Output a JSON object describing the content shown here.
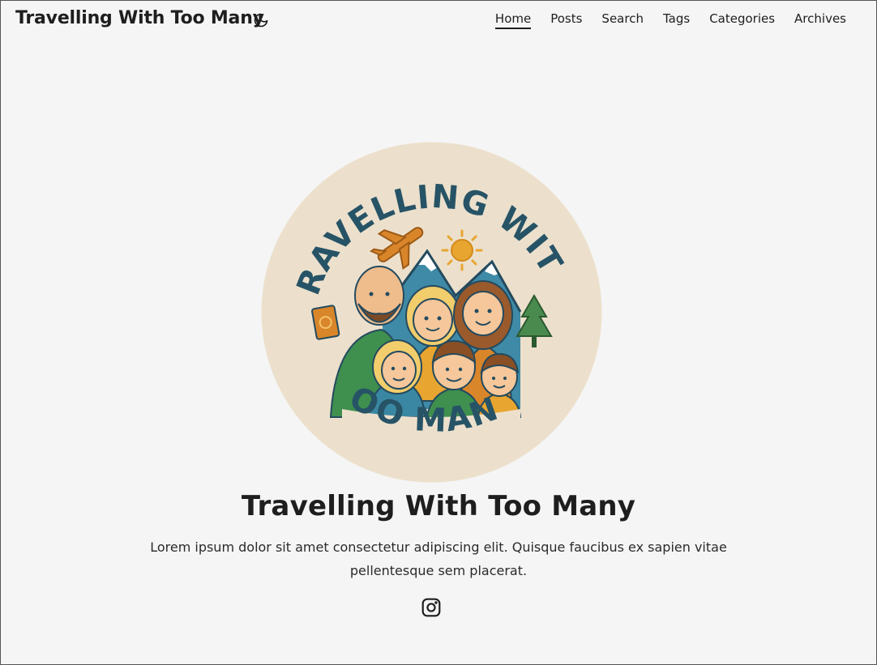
{
  "header": {
    "site_title": "Travelling With Too Many",
    "theme_toggle_icon": "moon-icon",
    "nav": [
      {
        "label": "Home",
        "active": true
      },
      {
        "label": "Posts",
        "active": false
      },
      {
        "label": "Search",
        "active": false
      },
      {
        "label": "Tags",
        "active": false
      },
      {
        "label": "Categories",
        "active": false
      },
      {
        "label": "Archives",
        "active": false
      }
    ]
  },
  "hero": {
    "logo": {
      "arc_text_top": "TRAVELLING WITH",
      "arc_text_bottom": "TOO MANY",
      "background_color": "#ece0cc",
      "text_color": "#275366"
    },
    "title": "Travelling With Too Many",
    "description": "Lorem ipsum dolor sit amet consectetur adipiscing elit. Quisque faucibus ex sapien vitae pellentesque sem placerat.",
    "social": [
      {
        "name": "instagram",
        "icon": "instagram-icon"
      }
    ]
  }
}
